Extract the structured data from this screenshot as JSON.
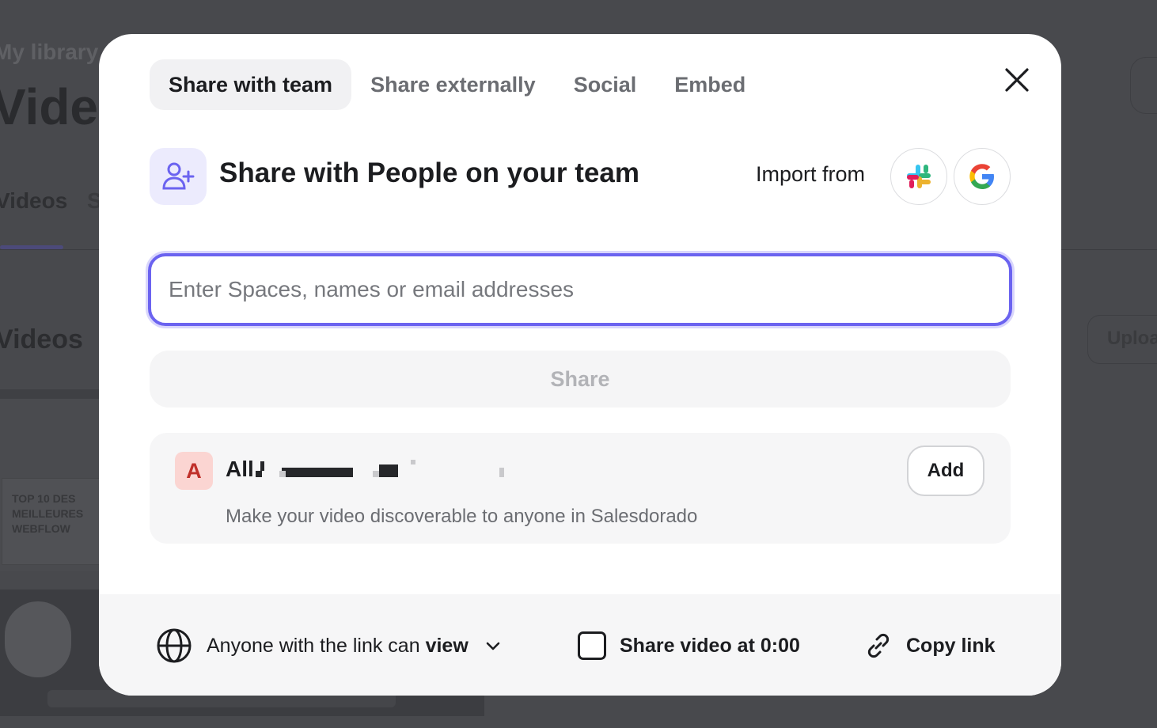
{
  "background": {
    "breadcrumb": "My library",
    "title": "Videos",
    "tabs": [
      "Videos",
      "S"
    ],
    "section_title": "Videos",
    "upload_label": "Uploa",
    "thumbnail_text": [
      "TOP 10 DES",
      "MEILLEURES",
      "WEBFLOW"
    ]
  },
  "modal": {
    "tabs": [
      {
        "label": "Share with team",
        "active": true
      },
      {
        "label": "Share externally",
        "active": false
      },
      {
        "label": "Social",
        "active": false
      },
      {
        "label": "Embed",
        "active": false
      }
    ],
    "heading": "Share with People on your team",
    "import_label": "Import from",
    "import_sources": [
      "slack-icon",
      "google-icon"
    ],
    "search": {
      "placeholder": "Enter Spaces, names or email addresses",
      "value": ""
    },
    "share_button": "Share",
    "team_card": {
      "avatar_letter": "A",
      "name": "All",
      "description": "Make your video discoverable to anyone in Salesdorado",
      "add_button": "Add"
    },
    "footer": {
      "access_prefix": "Anyone with the link can ",
      "access_level": "view",
      "share_at": "Share video at 0:00",
      "copy_link": "Copy link"
    }
  },
  "colors": {
    "accent": "#6b63f0",
    "avatar_bg": "#fbd5d2",
    "avatar_fg": "#c0302a",
    "overlay": "#444549"
  }
}
